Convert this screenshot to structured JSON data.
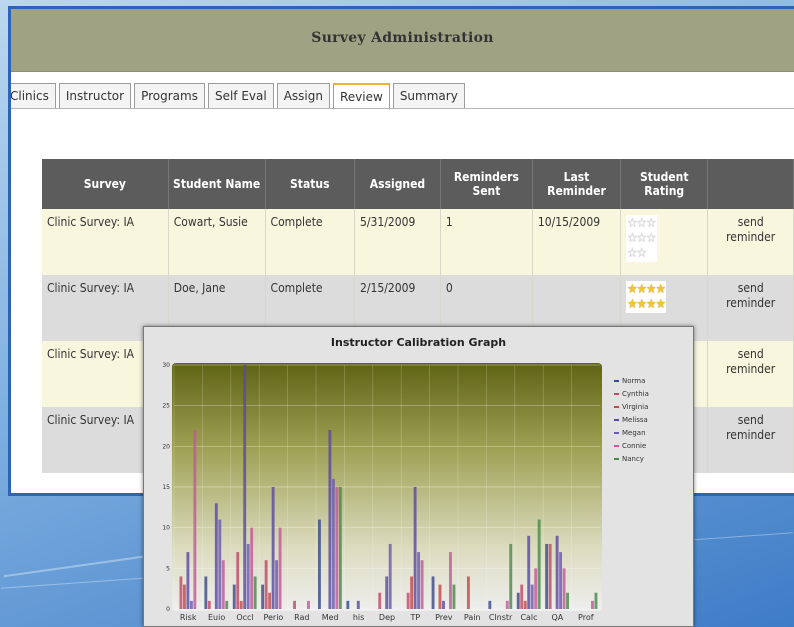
{
  "window": {
    "title": "Survey Administration"
  },
  "tabs": [
    {
      "label": "Clinics",
      "active": false
    },
    {
      "label": "Instructor",
      "active": false
    },
    {
      "label": "Programs",
      "active": false
    },
    {
      "label": "Self Eval",
      "active": false
    },
    {
      "label": "Assign",
      "active": false
    },
    {
      "label": "Review",
      "active": true
    },
    {
      "label": "Summary",
      "active": false
    }
  ],
  "table": {
    "headers": {
      "survey": "Survey",
      "student": "Student Name",
      "status": "Status",
      "assigned": "Assigned",
      "reminders": "Reminders Sent",
      "last": "Last Reminder",
      "rating": "Student Rating",
      "action": ""
    },
    "rows": [
      {
        "survey": "Clinic Survey: IA",
        "student": "Cowart, Susie",
        "status": "Complete",
        "assigned": "5/31/2009",
        "reminders": "1",
        "last": "10/15/2009",
        "rating": 0,
        "action": "send reminder"
      },
      {
        "survey": "Clinic Survey: IA",
        "student": "Doe, Jane",
        "status": "Complete",
        "assigned": "2/15/2009",
        "reminders": "0",
        "last": "",
        "rating": 5,
        "action": "send reminder"
      },
      {
        "survey": "Clinic Survey: IA",
        "student": "",
        "status": "",
        "assigned": "",
        "reminders": "",
        "last": "",
        "rating": null,
        "action": "send reminder"
      },
      {
        "survey": "Clinic Survey: IA",
        "student": "",
        "status": "",
        "assigned": "",
        "reminders": "",
        "last": "",
        "rating": null,
        "action": "send reminder"
      }
    ]
  },
  "graph": {
    "title": "Instructor Calibration Graph",
    "legend": [
      {
        "name": "Norma",
        "color": "#3a4a8a"
      },
      {
        "name": "Cynthia",
        "color": "#c04a6a"
      },
      {
        "name": "Virginia",
        "color": "#c04a4a"
      },
      {
        "name": "Melissa",
        "color": "#5a4aa0"
      },
      {
        "name": "Megan",
        "color": "#6a5ab0"
      },
      {
        "name": "Connie",
        "color": "#c05a9a"
      },
      {
        "name": "Nancy",
        "color": "#4a8a4a"
      }
    ]
  },
  "chart_data": {
    "type": "bar",
    "title": "Instructor Calibration Graph",
    "categories": [
      "Risk",
      "Euio",
      "Occl",
      "Perio",
      "Rad",
      "Med",
      "his",
      "Dep",
      "TP",
      "Prev",
      "Pain",
      "Clnstr",
      "Calc",
      "QA",
      "Prof"
    ],
    "ylim": [
      0,
      30
    ],
    "yticks": [
      0,
      5,
      10,
      15,
      20,
      25,
      30
    ],
    "grid": true,
    "legend_position": "right",
    "series": [
      {
        "name": "Norma",
        "values": [
          0,
          4,
          3,
          3,
          0,
          11,
          1,
          0,
          0,
          4,
          0,
          1,
          2,
          8,
          0
        ]
      },
      {
        "name": "Cynthia",
        "values": [
          4,
          1,
          7,
          6,
          1,
          0,
          0,
          2,
          2,
          0,
          0,
          0,
          3,
          8,
          0
        ]
      },
      {
        "name": "Virginia",
        "values": [
          3,
          0,
          1,
          2,
          0,
          0,
          0,
          0,
          4,
          3,
          4,
          0,
          1,
          0,
          0
        ]
      },
      {
        "name": "Melissa",
        "values": [
          7,
          13,
          30,
          15,
          0,
          22,
          1,
          4,
          15,
          1,
          0,
          0,
          9,
          9,
          0
        ]
      },
      {
        "name": "Megan",
        "values": [
          1,
          11,
          8,
          6,
          0,
          16,
          0,
          8,
          7,
          0,
          0,
          0,
          3,
          7,
          0
        ]
      },
      {
        "name": "Connie",
        "values": [
          22,
          6,
          10,
          10,
          1,
          15,
          0,
          0,
          6,
          7,
          0,
          1,
          5,
          5,
          1
        ]
      },
      {
        "name": "Nancy",
        "values": [
          0,
          1,
          4,
          0,
          0,
          15,
          0,
          0,
          0,
          3,
          0,
          8,
          11,
          2,
          2
        ]
      }
    ]
  }
}
